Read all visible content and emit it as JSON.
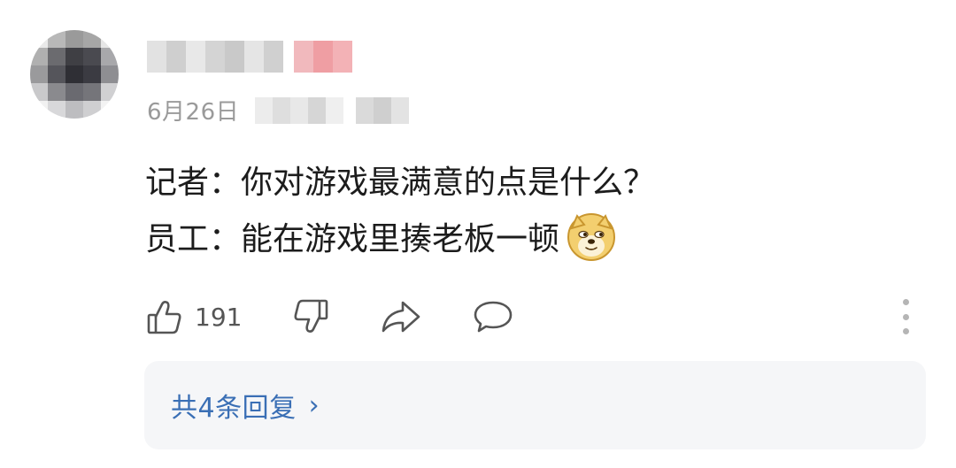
{
  "comment": {
    "date": "6月26日",
    "lines": [
      "记者：你对游戏最满意的点是什么？",
      "员工：能在游戏里揍老板一顿"
    ],
    "emoji_icon": "doge-emoji-icon",
    "likes": "191"
  },
  "actions": {
    "like_icon": "thumbs-up-icon",
    "dislike_icon": "thumbs-down-icon",
    "share_icon": "share-icon",
    "reply_icon": "comment-bubble-icon",
    "more_icon": "more-vertical-icon"
  },
  "replies": {
    "label": "共4条回复",
    "chevron": "›"
  },
  "colors": {
    "link": "#3a6fb5",
    "muted": "#9a9a9a",
    "reply_bg": "#f5f6f8"
  }
}
